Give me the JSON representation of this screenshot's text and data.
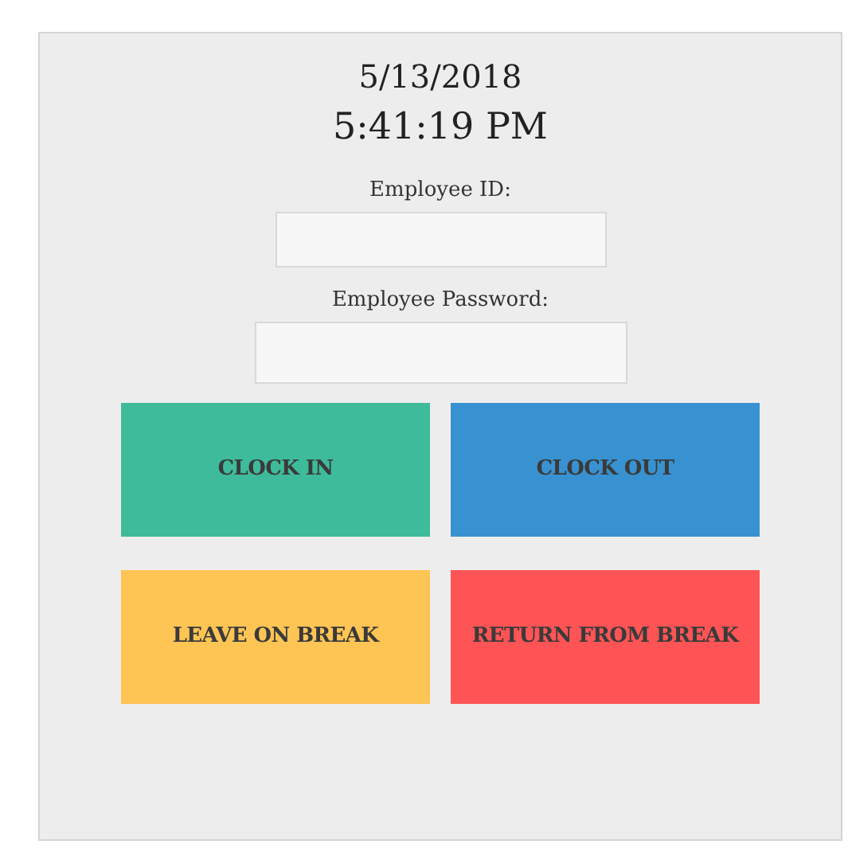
{
  "date": "5/13/2018",
  "time": "5:41:19 PM",
  "fields": [
    {
      "kind": "text",
      "label": "Employee ID:"
    },
    {
      "kind": "password",
      "label": "Employee Password:"
    }
  ],
  "buttons": [
    {
      "label": "CLOCK IN",
      "color": "#3ebb9b"
    },
    {
      "label": "CLOCK OUT",
      "color": "#3892d1"
    },
    {
      "label": "LEAVE ON BREAK",
      "color": "#fec454"
    },
    {
      "label": "RETURN FROM BREAK",
      "color": "#fe5455"
    }
  ]
}
